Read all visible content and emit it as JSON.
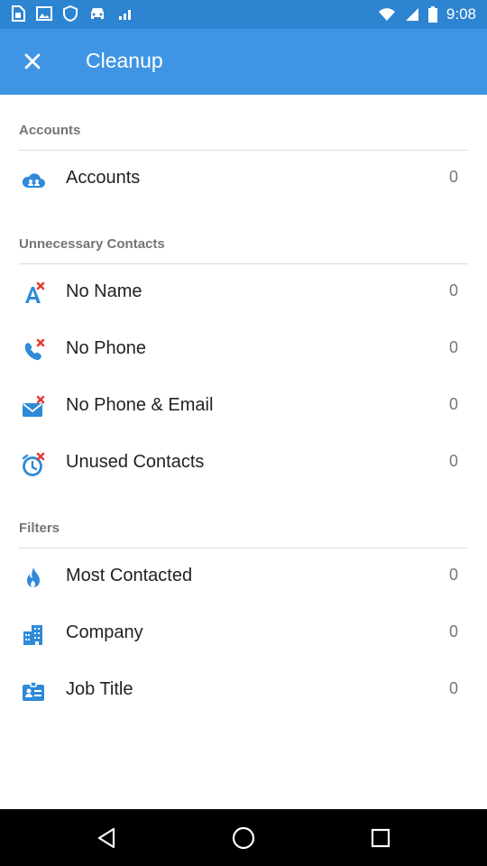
{
  "status_bar": {
    "time": "9:08",
    "left_icons": [
      "sim-icon",
      "gallery-icon",
      "vpn-icon",
      "car-icon",
      "signal-icon"
    ],
    "right_icons": [
      "wifi-icon",
      "cellular-icon",
      "battery-icon"
    ]
  },
  "app_bar": {
    "title": "Cleanup",
    "close_icon": "close-icon"
  },
  "sections": [
    {
      "header": "Accounts",
      "items": [
        {
          "label": "Accounts",
          "count": "0",
          "icon": "cloud-accounts-icon"
        }
      ]
    },
    {
      "header": "Unnecessary Contacts",
      "items": [
        {
          "label": "No Name",
          "count": "0",
          "icon": "no-name-icon"
        },
        {
          "label": "No Phone",
          "count": "0",
          "icon": "no-phone-icon"
        },
        {
          "label": "No Phone & Email",
          "count": "0",
          "icon": "no-phone-email-icon"
        },
        {
          "label": "Unused Contacts",
          "count": "0",
          "icon": "unused-contacts-icon"
        }
      ]
    },
    {
      "header": "Filters",
      "items": [
        {
          "label": "Most Contacted",
          "count": "0",
          "icon": "flame-icon"
        },
        {
          "label": "Company",
          "count": "0",
          "icon": "building-icon"
        },
        {
          "label": "Job Title",
          "count": "0",
          "icon": "id-card-icon"
        }
      ]
    }
  ],
  "nav_bar": {
    "icons": [
      "back-icon",
      "home-icon",
      "recents-icon"
    ]
  },
  "colors": {
    "status_bar": "#2d84d1",
    "app_bar": "#3f95e4",
    "icon_blue": "#2f8ad8",
    "icon_red": "#e53935",
    "header_text": "#757575",
    "divider": "#dcdcdc"
  }
}
